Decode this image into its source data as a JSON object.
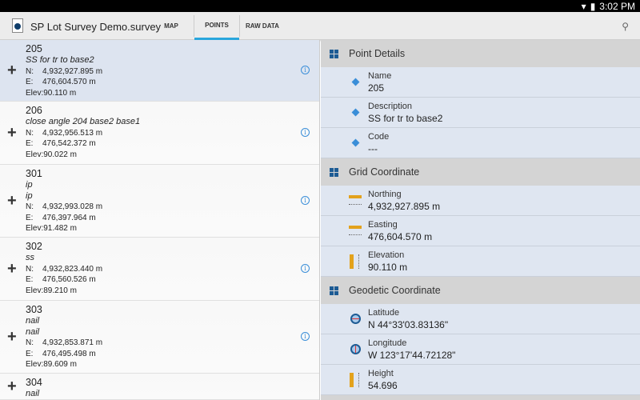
{
  "status_bar": {
    "time": "3:02 PM",
    "icons": [
      "wifi-icon",
      "battery-icon"
    ]
  },
  "toolbar": {
    "title": "SP Lot Survey Demo.survey",
    "tabs": [
      {
        "label": "MAP",
        "active": false
      },
      {
        "label": "POINTS",
        "active": true
      },
      {
        "label": "RAW DATA",
        "active": false
      }
    ],
    "search_icon": "search-icon"
  },
  "labels": {
    "n": "N:",
    "e": "E:",
    "elev": "Elev:"
  },
  "points": [
    {
      "name": "205",
      "descs": [
        "SS for tr to base2"
      ],
      "n": "4,932,927.895 m",
      "e": "476,604.570 m",
      "elev": "90.110 m",
      "selected": true
    },
    {
      "name": "206",
      "descs": [
        "close angle  204 base2 base1"
      ],
      "n": "4,932,956.513 m",
      "e": "476,542.372 m",
      "elev": "90.022 m"
    },
    {
      "name": "301",
      "descs": [
        "ip",
        "ip"
      ],
      "n": "4,932,993.028 m",
      "e": "476,397.964 m",
      "elev": "91.482 m"
    },
    {
      "name": "302",
      "descs": [
        "ss"
      ],
      "n": "4,932,823.440 m",
      "e": "476,560.526 m",
      "elev": "89.210 m"
    },
    {
      "name": "303",
      "descs": [
        "nail",
        "nail"
      ],
      "n": "4,932,853.871 m",
      "e": "476,495.498 m",
      "elev": "89.609 m"
    },
    {
      "name": "304",
      "descs": [
        "nail"
      ],
      "n": "",
      "e": "",
      "elev": ""
    }
  ],
  "details": {
    "point_details": {
      "title": "Point Details",
      "items": [
        {
          "label": "Name",
          "value": "205"
        },
        {
          "label": "Description",
          "value": "SS for tr to base2"
        },
        {
          "label": "Code",
          "value": "---"
        }
      ]
    },
    "grid_coordinate": {
      "title": "Grid Coordinate",
      "items": [
        {
          "label": "Northing",
          "value": "4,932,927.895 m"
        },
        {
          "label": "Easting",
          "value": "476,604.570 m"
        },
        {
          "label": "Elevation",
          "value": "90.110 m"
        }
      ]
    },
    "geodetic_coordinate": {
      "title": "Geodetic Coordinate",
      "items": [
        {
          "label": "Latitude",
          "value": "N 44°33'03.83136\""
        },
        {
          "label": "Longitude",
          "value": "W 123°17'44.72128\""
        },
        {
          "label": "Height",
          "value": "54.696"
        }
      ]
    }
  },
  "colors": {
    "accent": "#2aa6dc",
    "selected_row": "#dde4f0",
    "header": "#d4d4d4",
    "icon_blue": "#1d5b94"
  }
}
